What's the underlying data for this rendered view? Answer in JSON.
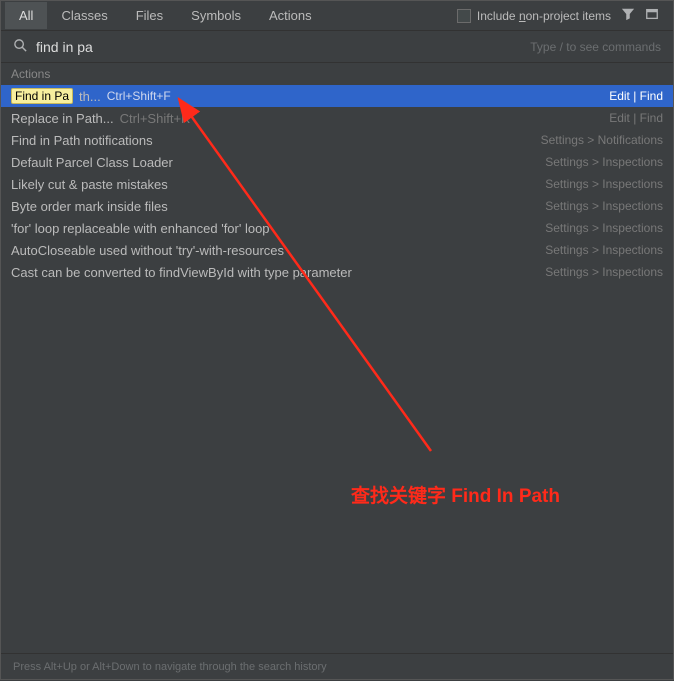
{
  "tabs": {
    "items": [
      "All",
      "Classes",
      "Files",
      "Symbols",
      "Actions"
    ],
    "active_index": 0,
    "include_nonproject": "Include non-project items"
  },
  "search": {
    "value": "find in pa",
    "hint": "Type / to see commands"
  },
  "section_label": "Actions",
  "results": [
    {
      "label": "Find in Path...",
      "highlighted_prefix": "Find in Pa",
      "shortcut": "Ctrl+Shift+F",
      "meta": "Edit | Find",
      "selected": true
    },
    {
      "label": "Replace in Path...",
      "shortcut": "Ctrl+Shift+R",
      "meta": "Edit | Find"
    },
    {
      "label": "Find in Path notifications",
      "meta": "Settings > Notifications"
    },
    {
      "label": "Default Parcel Class Loader",
      "meta": "Settings > Inspections"
    },
    {
      "label": "Likely cut & paste mistakes",
      "meta": "Settings > Inspections"
    },
    {
      "label": "Byte order mark inside files",
      "meta": "Settings > Inspections"
    },
    {
      "label": "'for' loop replaceable with enhanced 'for' loop",
      "meta": "Settings > Inspections"
    },
    {
      "label": "AutoCloseable used without 'try'-with-resources",
      "meta": "Settings > Inspections"
    },
    {
      "label": "Cast can be converted to findViewById with type parameter",
      "meta": "Settings > Inspections"
    }
  ],
  "footer": "Press Alt+Up or Alt+Down to navigate through the search history",
  "annotation": "查找关键字 Find In Path"
}
